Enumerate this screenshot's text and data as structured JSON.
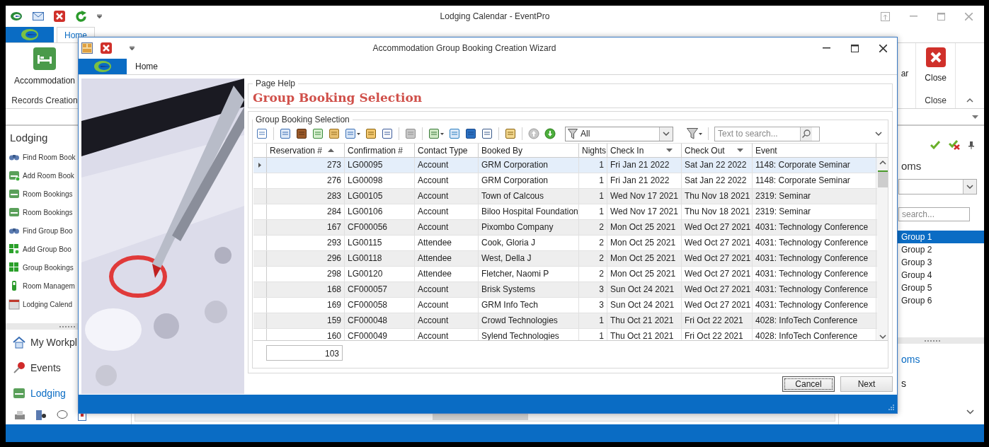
{
  "window": {
    "title": "Lodging Calendar - EventPro"
  },
  "ribbon": {
    "tabs": [
      {
        "label": "Home",
        "selected": true
      }
    ],
    "records_group": {
      "button": "Accommodation",
      "label": "Records Creation"
    },
    "partial_button": "ar",
    "close_group": {
      "button": "Close",
      "label": "Close"
    }
  },
  "sidebar": {
    "title": "Lodging",
    "items": [
      "Find Room Book",
      "Add Room Book",
      "Room Bookings",
      "Room Bookings",
      "Find Group Boo",
      "Add Group Boo",
      "Group Bookings",
      "Room Managem",
      "Lodging Calend"
    ]
  },
  "navigation": [
    {
      "label": "My Workpl",
      "selected": false
    },
    {
      "label": "Events",
      "selected": false
    },
    {
      "label": "Lodging",
      "selected": true
    }
  ],
  "right_panel": {
    "title": "oms",
    "search_placeholder": "search...",
    "groups": [
      {
        "label": "Group 1",
        "selected": true
      },
      {
        "label": "Group 2",
        "selected": false
      },
      {
        "label": "Group 3",
        "selected": false
      },
      {
        "label": "Group 4",
        "selected": false
      },
      {
        "label": "Group 5",
        "selected": false
      },
      {
        "label": "Group 6",
        "selected": false
      }
    ],
    "link": "oms",
    "item": "s"
  },
  "dialog": {
    "title": "Accommodation Group Booking Creation Wizard",
    "tab": "Home",
    "page_help_label": "Page Help",
    "heading": "Group Booking Selection",
    "grid_group_label": "Group Booking Selection",
    "filter_value": "All",
    "search_placeholder": "Text to search...",
    "columns": [
      {
        "label": "Reservation #",
        "sorted_ascending": true,
        "filter_button": false
      },
      {
        "label": "Confirmation #",
        "sorted_ascending": false,
        "filter_button": false
      },
      {
        "label": "Contact Type",
        "sorted_ascending": false,
        "filter_button": false
      },
      {
        "label": "Booked By",
        "sorted_ascending": false,
        "filter_button": false
      },
      {
        "label": "Nights",
        "sorted_ascending": false,
        "filter_button": false
      },
      {
        "label": "Check In",
        "sorted_ascending": false,
        "filter_button": true
      },
      {
        "label": "Check Out",
        "sorted_ascending": false,
        "filter_button": true
      },
      {
        "label": "Event",
        "sorted_ascending": false,
        "filter_button": false
      }
    ],
    "rows": [
      {
        "selected": true,
        "cells": [
          "273",
          "LG00095",
          "Account",
          "GRM Corporation",
          "1",
          "Fri Jan 21 2022",
          "Sat Jan 22 2022",
          "1148: Corporate Seminar"
        ]
      },
      {
        "selected": false,
        "cells": [
          "276",
          "LG00098",
          "Account",
          "GRM Corporation",
          "1",
          "Fri Jan 21 2022",
          "Sat Jan 22 2022",
          "1148: Corporate Seminar"
        ]
      },
      {
        "selected": false,
        "cells": [
          "283",
          "LG00105",
          "Account",
          "Town of Calcous",
          "1",
          "Wed Nov 17 2021",
          "Thu Nov 18 2021",
          "2319: Seminar"
        ]
      },
      {
        "selected": false,
        "cells": [
          "284",
          "LG00106",
          "Account",
          "Biloo Hospital Foundation",
          "1",
          "Wed Nov 17 2021",
          "Thu Nov 18 2021",
          "2319: Seminar"
        ]
      },
      {
        "selected": false,
        "cells": [
          "167",
          "CF000056",
          "Account",
          "Pixombo Company",
          "2",
          "Mon Oct 25 2021",
          "Wed Oct 27 2021",
          "4031: Technology Conference"
        ]
      },
      {
        "selected": false,
        "cells": [
          "293",
          "LG00115",
          "Attendee",
          "Cook, Gloria J",
          "2",
          "Mon Oct 25 2021",
          "Wed Oct 27 2021",
          "4031: Technology Conference"
        ]
      },
      {
        "selected": false,
        "cells": [
          "296",
          "LG00118",
          "Attendee",
          "West, Della J",
          "2",
          "Mon Oct 25 2021",
          "Wed Oct 27 2021",
          "4031: Technology Conference"
        ]
      },
      {
        "selected": false,
        "cells": [
          "298",
          "LG00120",
          "Attendee",
          "Fletcher, Naomi P",
          "2",
          "Mon Oct 25 2021",
          "Wed Oct 27 2021",
          "4031: Technology Conference"
        ]
      },
      {
        "selected": false,
        "cells": [
          "168",
          "CF000057",
          "Account",
          "Brisk Systems",
          "3",
          "Sun Oct 24 2021",
          "Wed Oct 27 2021",
          "4031: Technology Conference"
        ]
      },
      {
        "selected": false,
        "cells": [
          "169",
          "CF000058",
          "Account",
          "GRM Info Tech",
          "3",
          "Sun Oct 24 2021",
          "Wed Oct 27 2021",
          "4031: Technology Conference"
        ]
      },
      {
        "selected": false,
        "cells": [
          "159",
          "CF000048",
          "Account",
          "Crowd Technologies",
          "1",
          "Thu Oct 21 2021",
          "Fri Oct 22 2021",
          "4028: InfoTech Conference"
        ]
      },
      {
        "selected": false,
        "cells": [
          "160",
          "CF000049",
          "Account",
          "Sylend Technologies",
          "1",
          "Thu Oct 21 2021",
          "Fri Oct 22 2021",
          "4028: InfoTech Conference"
        ]
      }
    ],
    "summary": "103",
    "buttons": [
      {
        "label": "Cancel",
        "focused": true
      },
      {
        "label": "Next",
        "focused": false
      }
    ]
  }
}
